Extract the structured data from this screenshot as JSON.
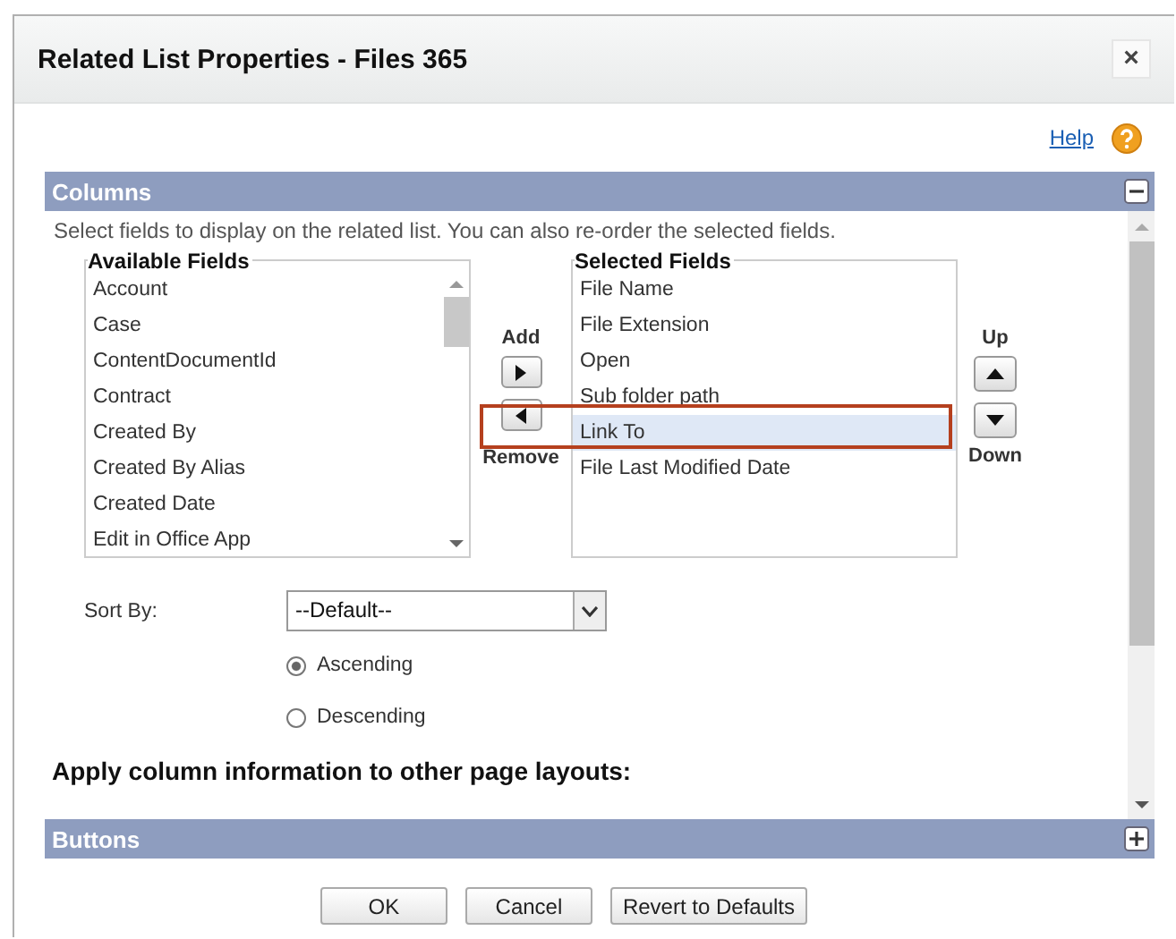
{
  "window": {
    "title": "Related List Properties - Files 365",
    "close": "×"
  },
  "help": {
    "label": "Help"
  },
  "columns_section": {
    "title": "Columns",
    "expanded": true,
    "instructions": "Select fields to display on the related list. You can also re-order the selected fields.",
    "available_fields": {
      "legend": "Available Fields",
      "items": [
        "Account",
        "Case",
        "ContentDocumentId",
        "Contract",
        "Created By",
        "Created By Alias",
        "Created Date",
        "Edit in Office App"
      ]
    },
    "selected_fields": {
      "legend": "Selected Fields",
      "items": [
        {
          "label": "File Name",
          "selected": false
        },
        {
          "label": "File Extension",
          "selected": false
        },
        {
          "label": "Open",
          "selected": false
        },
        {
          "label": "Sub folder path",
          "selected": false
        },
        {
          "label": "Link To",
          "selected": true
        },
        {
          "label": "File Last Modified Date",
          "selected": false
        }
      ]
    },
    "add": "Add",
    "remove": "Remove",
    "up": "Up",
    "down": "Down",
    "sort_by": {
      "label": "Sort By:",
      "value": "--Default--"
    },
    "sort_order": [
      {
        "label": "Ascending",
        "selected": true
      },
      {
        "label": "Descending",
        "selected": false
      }
    ],
    "apply_heading": "Apply column information to other page layouts:"
  },
  "buttons_section": {
    "title": "Buttons",
    "expanded": false
  },
  "footer_buttons": [
    "OK",
    "Cancel",
    "Revert to Defaults"
  ]
}
